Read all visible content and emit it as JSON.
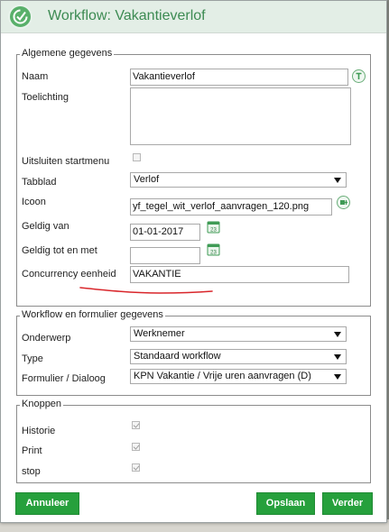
{
  "window": {
    "title": "Workflow: Vakantieverlof"
  },
  "general": {
    "legend": "Algemene gegevens",
    "naam": {
      "label": "Naam",
      "value": "Vakantieverlof"
    },
    "toelichting": {
      "label": "Toelichting",
      "value": ""
    },
    "uitsluiten": {
      "label": "Uitsluiten startmenu",
      "checked": false
    },
    "tabblad": {
      "label": "Tabblad",
      "value": "Verlof"
    },
    "icoon": {
      "label": "Icoon",
      "value": "yf_tegel_wit_verlof_aanvragen_120.png"
    },
    "geldig_van": {
      "label": "Geldig van",
      "value": "01-01-2017"
    },
    "geldig_tot": {
      "label": "Geldig tot en met",
      "value": ""
    },
    "concurrency": {
      "label": "Concurrency eenheid",
      "value": "VAKANTIE"
    }
  },
  "workflow": {
    "legend": "Workflow en formulier gegevens",
    "onderwerp": {
      "label": "Onderwerp",
      "value": "Werknemer"
    },
    "type": {
      "label": "Type",
      "value": "Standaard workflow"
    },
    "formulier": {
      "label": "Formulier / Dialoog",
      "value": "KPN Vakantie / Vrije uren aanvragen (D)"
    }
  },
  "buttons_section": {
    "legend": "Knoppen",
    "historie": {
      "label": "Historie",
      "checked": true
    },
    "print": {
      "label": "Print",
      "checked": true
    },
    "stop": {
      "label": "stop",
      "checked": true
    }
  },
  "footer": {
    "annuleer": "Annuleer",
    "opslaan": "Opslaan",
    "verder": "Verder"
  },
  "colors": {
    "accent": "#26a03c",
    "title": "#3d8b53",
    "annotation": "#d9262b"
  }
}
